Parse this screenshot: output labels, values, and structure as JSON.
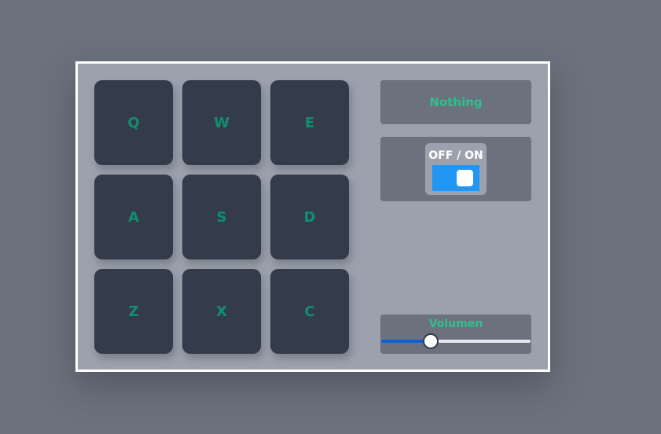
{
  "pads": [
    {
      "key": "Q"
    },
    {
      "key": "W"
    },
    {
      "key": "E"
    },
    {
      "key": "A"
    },
    {
      "key": "S"
    },
    {
      "key": "D"
    },
    {
      "key": "Z"
    },
    {
      "key": "X"
    },
    {
      "key": "C"
    }
  ],
  "display": {
    "text": "Nothing"
  },
  "power": {
    "label": "OFF / ON",
    "state": "on"
  },
  "volume": {
    "label": "Volumen",
    "value": 0.33
  },
  "colors": {
    "background": "#6b717d",
    "panel": "#9ca2ad",
    "pad": "#343c4b",
    "pad_text": "#0f8f6e",
    "accent_text": "#2fc08f",
    "toggle_on": "#2196f3",
    "slider_fill": "#0d5fd6"
  }
}
